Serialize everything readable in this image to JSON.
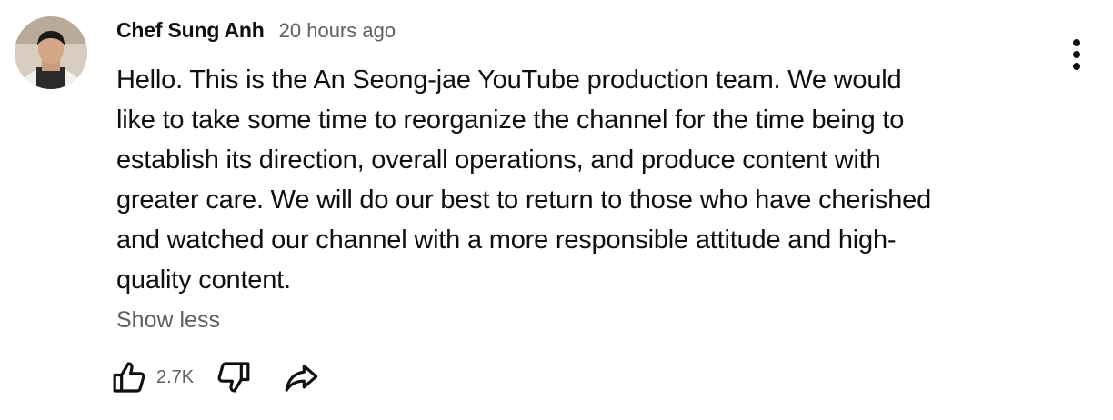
{
  "comment": {
    "author": "Chef Sung Anh",
    "timestamp": "20 hours ago",
    "text_lines": [
      "Hello. This is the An Seong-jae YouTube production team. We would",
      "like to take some time to reorganize the channel for the time being to",
      "establish its direction, overall operations, and produce content with",
      "greater care. We will do our best to return to those who have cherished",
      "and watched our channel with a more responsible attitude and high-",
      "quality content."
    ],
    "show_less_label": "Show less",
    "like_count": "2.7K"
  },
  "icons": {
    "avatar": "avatar-photo",
    "menu": "more-vertical-icon",
    "like": "thumbs-up-icon",
    "dislike": "thumbs-down-icon",
    "share": "share-arrow-icon"
  },
  "colors": {
    "text_primary": "#0f0f0f",
    "text_secondary": "#606060",
    "background": "#ffffff"
  }
}
